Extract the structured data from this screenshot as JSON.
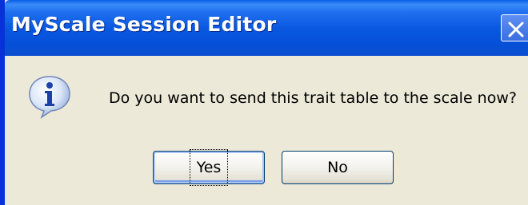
{
  "dialog": {
    "title": "MyScale Session Editor",
    "message": "Do you want to send this trait table to the scale now?",
    "icon": "info-icon",
    "buttons": {
      "yes_label": "Yes",
      "no_label": "No"
    },
    "close_icon": "close-icon"
  },
  "colors": {
    "titlebar": "#0a58e0",
    "dialog_background": "#ece9d8",
    "button_border": "#003c74"
  }
}
